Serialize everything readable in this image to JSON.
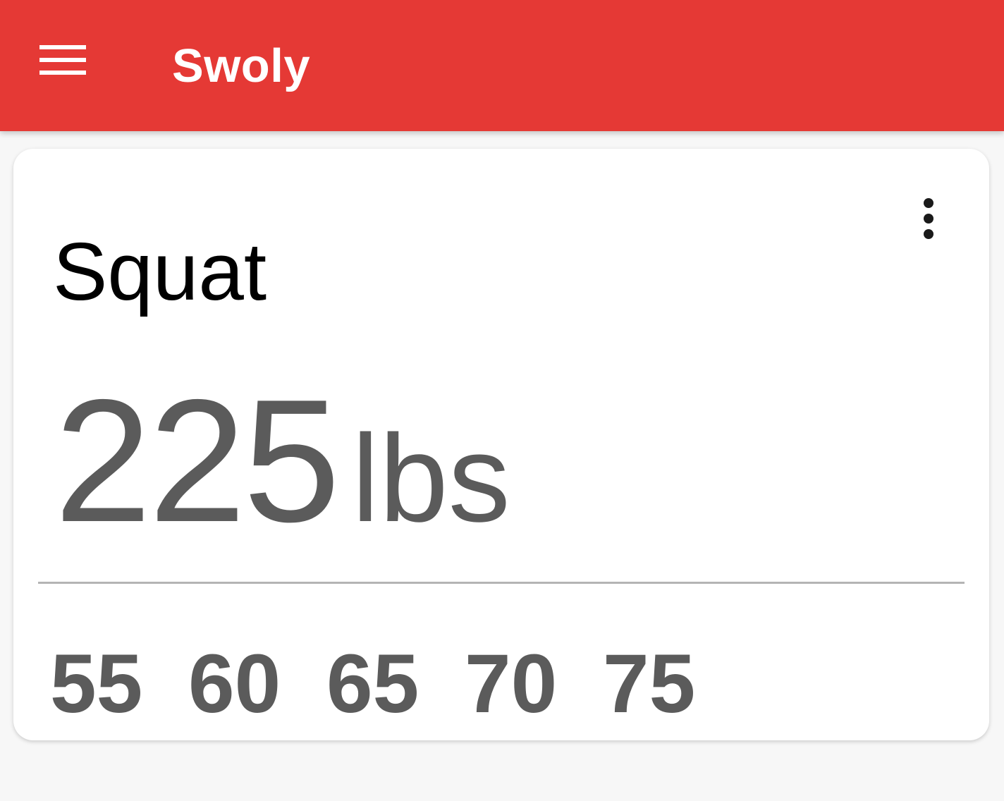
{
  "app_bar": {
    "title": "Swoly",
    "menu_icon": "hamburger-menu-icon",
    "background_color": "#e53935"
  },
  "card": {
    "exercise": "Squat",
    "weight": "225",
    "unit": "lbs",
    "overflow_icon": "more-vert-icon",
    "plates": [
      "55",
      "60",
      "65",
      "70",
      "75"
    ]
  }
}
